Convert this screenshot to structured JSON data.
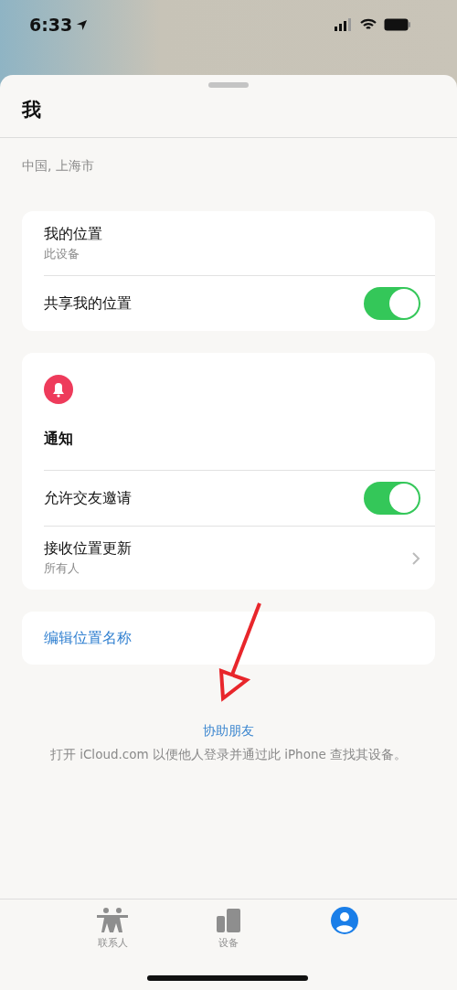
{
  "status_bar": {
    "time": "6:33"
  },
  "sheet": {
    "title": "我",
    "location": "中国, 上海市"
  },
  "location_card": {
    "rows": [
      {
        "kind": "info",
        "label": "我的位置",
        "sublabel": "此设备"
      },
      {
        "kind": "toggle",
        "label": "共享我的位置",
        "on": true
      }
    ]
  },
  "notifications_card": {
    "title": "通知",
    "rows": [
      {
        "kind": "toggle",
        "label": "允许交友邀请",
        "on": true
      },
      {
        "kind": "link",
        "label": "接收位置更新",
        "sublabel": "所有人"
      }
    ]
  },
  "edit_card": {
    "label": "编辑位置名称"
  },
  "help": {
    "link": "协助朋友",
    "description": "打开 iCloud.com 以便他人登录并通过此 iPhone 查找其设备。"
  },
  "tabs": [
    {
      "kind": "people",
      "label": "联系人",
      "selected": false
    },
    {
      "kind": "devices",
      "label": "设备",
      "selected": false
    },
    {
      "kind": "me",
      "selected": true
    }
  ]
}
